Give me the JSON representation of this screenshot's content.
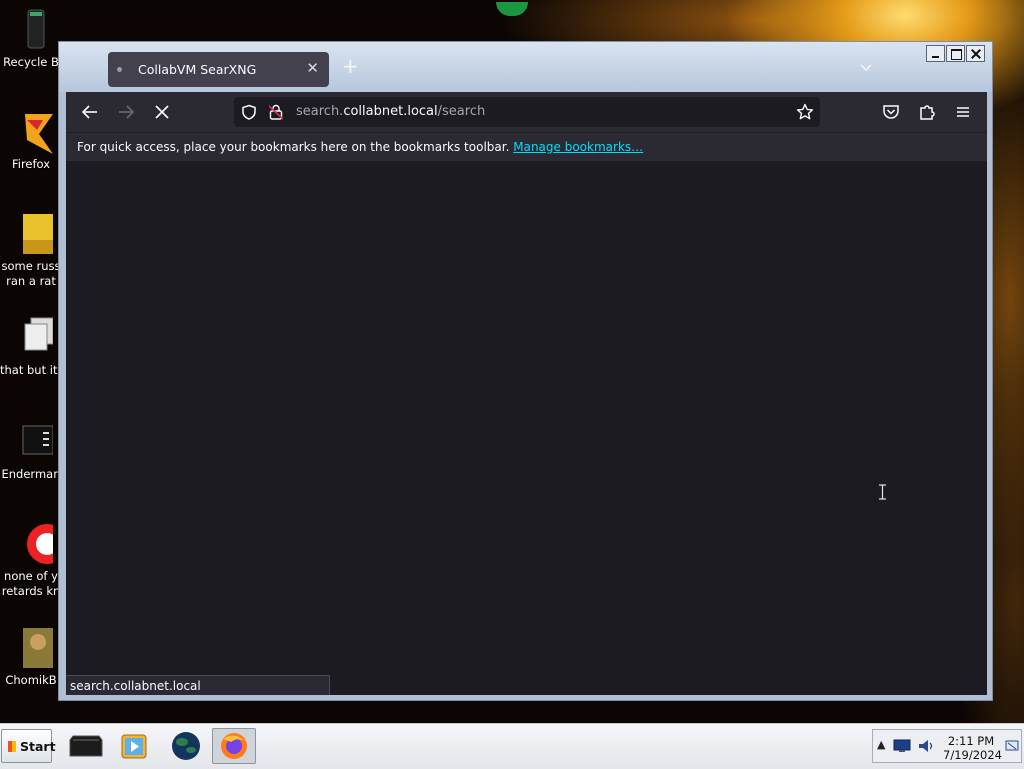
{
  "desktop": {
    "icons": [
      {
        "label": "Recycle B",
        "icon": "recycle-bin-icon"
      },
      {
        "label": "Firefox",
        "icon": "firefox-icon"
      },
      {
        "label": "some russ",
        "label2": "ran a rat",
        "icon": "folder-icon"
      },
      {
        "label": "that but its",
        "icon": "shortcut-icon"
      },
      {
        "label": "Enderman",
        "icon": "window-icon"
      },
      {
        "label": "none of y",
        "label2": "retards kn",
        "icon": "red-circle-icon"
      },
      {
        "label": "ChomikB",
        "icon": "chomik-icon"
      }
    ]
  },
  "browser": {
    "tab": {
      "title": "CollabVM SearXNG"
    },
    "url": {
      "scheme": "search.",
      "host": "collabnet.local",
      "path": "/search"
    },
    "bookmarks_bar": {
      "message": "For quick access, place your bookmarks here on the bookmarks toolbar.",
      "link": "Manage bookmarks…"
    },
    "status": "search.collabnet.local",
    "colors": {
      "toolbar": "#2b2a33",
      "content": "#1c1b22",
      "link": "#00ddff"
    }
  },
  "taskbar": {
    "start_label": "Start",
    "apps": [
      "terminal-icon",
      "media-player-icon",
      "globe-icon",
      "firefox-icon"
    ],
    "tray": {
      "time": "2:11 PM",
      "date": "7/19/2024"
    }
  }
}
